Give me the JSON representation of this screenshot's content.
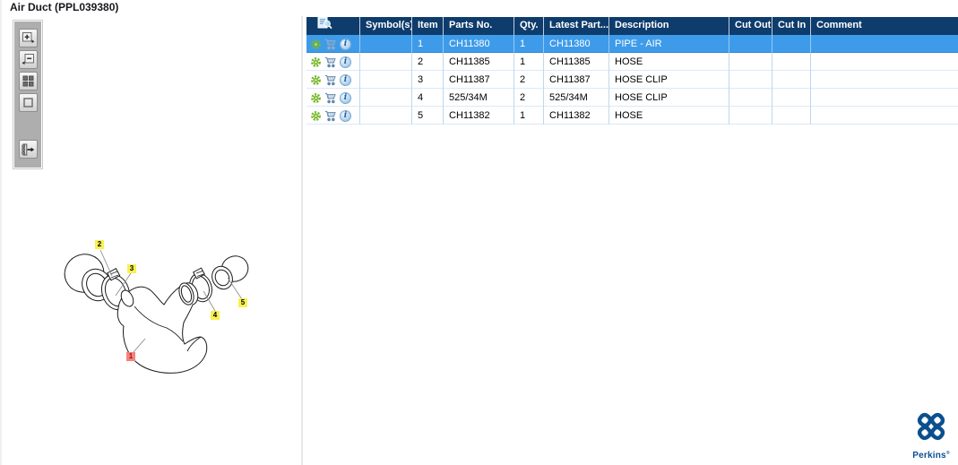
{
  "window": {
    "title": "Air Duct (PPL039380)"
  },
  "colors": {
    "header_bg": "#0E3C6C",
    "selected_row_bg": "#3E9BEA",
    "grid_line": "#BFD8EC",
    "gear_green": "#76B82A",
    "cart_blue": "#6288AE",
    "label_yellow": "#F8F150",
    "label_selected_red": "#F4837E",
    "perkins_blue": "#0B4F8F"
  },
  "toolbar": {
    "icons": [
      "zoom-in-icon",
      "zoom-out-icon",
      "tile-squares-icon",
      "rectangle-icon",
      "list-arrow-icon"
    ]
  },
  "table": {
    "columns": [
      "",
      "Symbol(s)",
      "Item",
      "Parts No.",
      "Qty.",
      "Latest Part...",
      "Description",
      "Cut Out",
      "Cut In",
      "Comment"
    ],
    "rows": [
      {
        "symbols": "",
        "item": "1",
        "parts_no": "CH11380",
        "qty": "1",
        "latest_part": "CH11380",
        "description": "PIPE - AIR",
        "cut_out": "",
        "cut_in": "",
        "comment": "",
        "selected": true
      },
      {
        "symbols": "",
        "item": "2",
        "parts_no": "CH11385",
        "qty": "1",
        "latest_part": "CH11385",
        "description": "HOSE",
        "cut_out": "",
        "cut_in": "",
        "comment": "",
        "selected": false
      },
      {
        "symbols": "",
        "item": "3",
        "parts_no": "CH11387",
        "qty": "2",
        "latest_part": "CH11387",
        "description": "HOSE CLIP",
        "cut_out": "",
        "cut_in": "",
        "comment": "",
        "selected": false
      },
      {
        "symbols": "",
        "item": "4",
        "parts_no": "525/34M",
        "qty": "2",
        "latest_part": "525/34M",
        "description": "HOSE CLIP",
        "cut_out": "",
        "cut_in": "",
        "comment": "",
        "selected": false
      },
      {
        "symbols": "",
        "item": "5",
        "parts_no": "CH11382",
        "qty": "1",
        "latest_part": "CH11382",
        "description": "HOSE",
        "cut_out": "",
        "cut_in": "",
        "comment": "",
        "selected": false
      }
    ]
  },
  "diagram": {
    "labels": [
      {
        "text": "1",
        "highlighted": true
      },
      {
        "text": "2",
        "highlighted": false
      },
      {
        "text": "3",
        "highlighted": false
      },
      {
        "text": "4",
        "highlighted": false
      },
      {
        "text": "5",
        "highlighted": false
      }
    ]
  },
  "logo": {
    "text": "Perkins",
    "mark": "®"
  }
}
